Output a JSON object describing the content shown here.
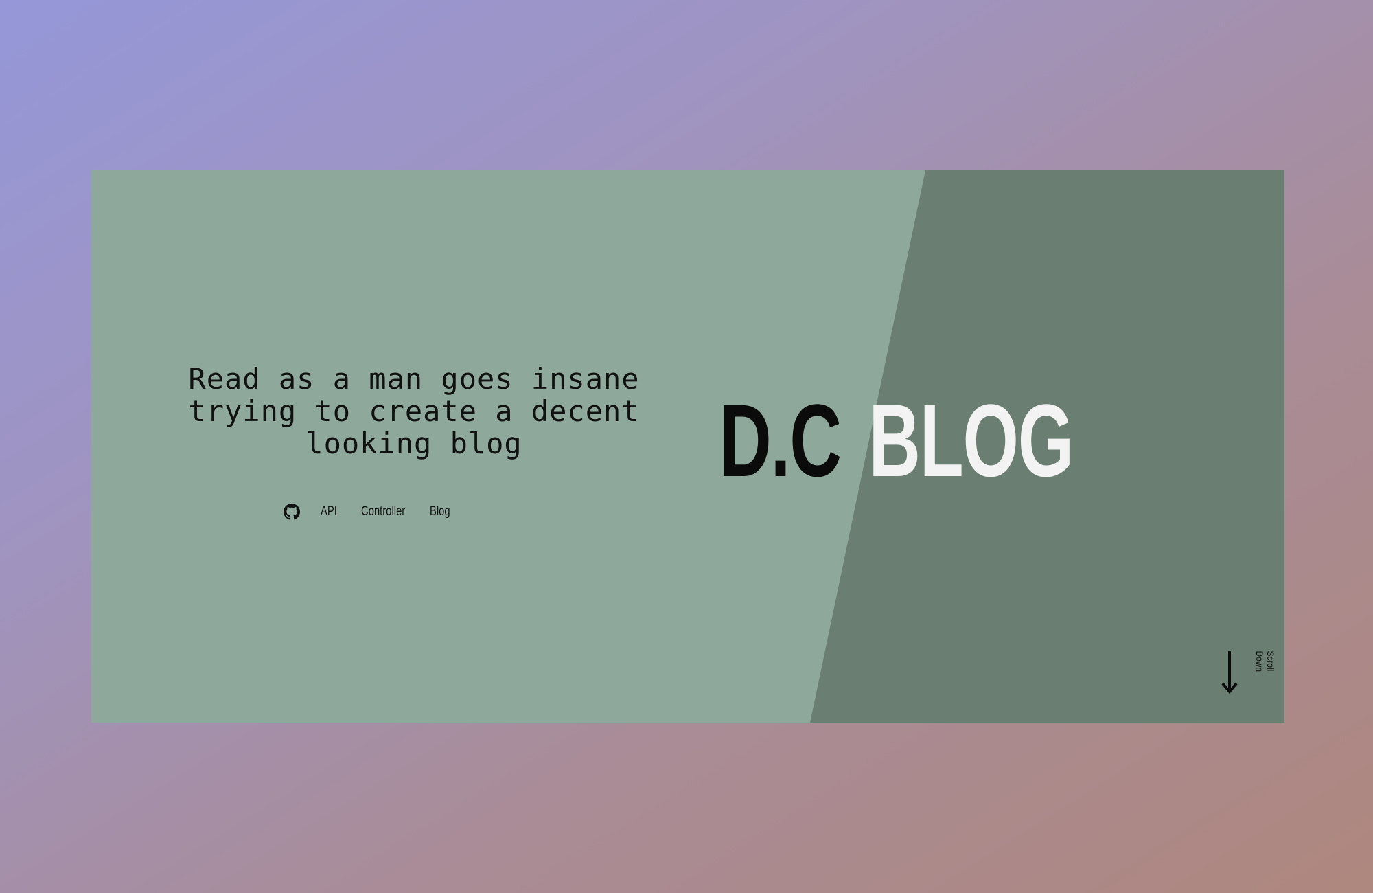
{
  "hero": {
    "tagline": "Read as a man goes insane trying to create a decent looking blog",
    "brand": {
      "part1": "D.C",
      "part2": "BLOG"
    },
    "scroll_label": "Scroll Down"
  },
  "nav": {
    "github_icon": "github-icon",
    "links": [
      {
        "label": "API"
      },
      {
        "label": "Controller"
      },
      {
        "label": "Blog"
      }
    ]
  },
  "colors": {
    "card_light": "#8ea99b",
    "card_dark": "#6a7e71",
    "brand_dark_text": "#0b0b0b",
    "brand_light_text": "#f3f3f3"
  }
}
